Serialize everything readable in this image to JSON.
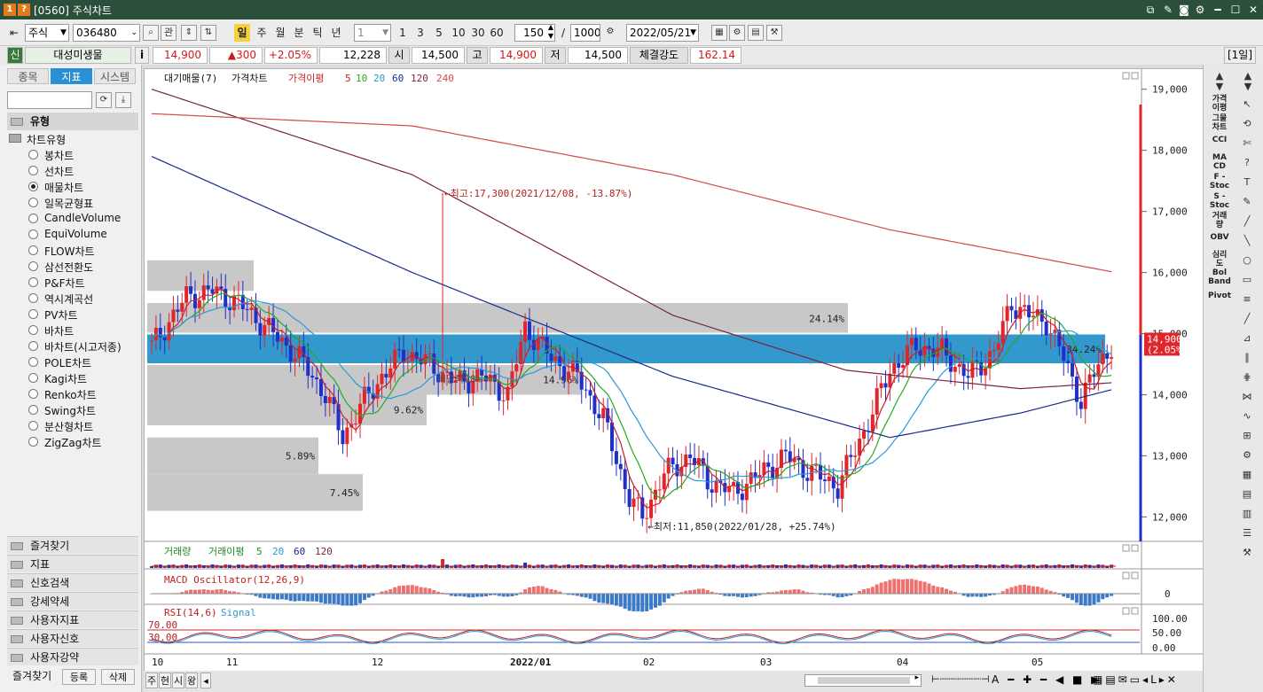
{
  "window": {
    "badge1": "1",
    "badge2": "?",
    "title": "[0560] 주식차트"
  },
  "toolbar": {
    "market": "주식",
    "code": "036480",
    "btn_kwan": "관",
    "periods": [
      "일",
      "주",
      "월",
      "분",
      "틱",
      "년"
    ],
    "period_unit": "1",
    "intervals": [
      "1",
      "3",
      "5",
      "10",
      "30",
      "60"
    ],
    "count": "150",
    "slash": "/",
    "total": "1000",
    "date": "2022/05/21"
  },
  "quote": {
    "sin": "신",
    "name": "대성미생물",
    "info": "i",
    "price": "14,900",
    "change": "▲300",
    "pct": "+2.05%",
    "volume": "12,228",
    "open_label": "시",
    "open": "14,500",
    "high_label": "고",
    "high": "14,900",
    "low_label": "저",
    "low": "14,500",
    "strength_label": "체결강도",
    "strength": "162.14",
    "period_badge": "[1일]"
  },
  "left": {
    "tabs": [
      "종목",
      "지표",
      "시스템"
    ],
    "category": "유형",
    "tree_root": "차트유형",
    "chart_types": [
      "봉차트",
      "선차트",
      "매물차트",
      "일목균형표",
      "CandleVolume",
      "EquiVolume",
      "FLOW차트",
      "삼선전환도",
      "P&F차트",
      "역시계곡선",
      "PV차트",
      "바차트",
      "바차트(시고저종)",
      "POLE차트",
      "Kagi차트",
      "Renko차트",
      "Swing차트",
      "분산형차트",
      "ZigZag차트"
    ],
    "selected": "매물차트",
    "sections": [
      "즐겨찾기",
      "지표",
      "신호검색",
      "강세약세",
      "사용자지표",
      "사용자신호",
      "사용자강약"
    ],
    "bottom": [
      "즐겨찾기",
      "등록",
      "삭제"
    ]
  },
  "legend": {
    "main": [
      "대기매물(7)",
      "가격차트",
      "가격이평",
      "5",
      "10",
      "20",
      "60",
      "120",
      "240"
    ],
    "vol": [
      "거래량",
      "거래이평",
      "5",
      "20",
      "60",
      "120"
    ],
    "macd": "MACD Oscillator(12,26,9)",
    "rsi": [
      "RSI(14,6)",
      "Signal"
    ]
  },
  "annotations": {
    "high": "←최고:17,300(2021/12/08, -13.87%)",
    "low": "←최저:11,850(2022/01/28, +25.74%)",
    "bandlabel": "배당락18%"
  },
  "colors": {
    "up": "#e0262b",
    "down": "#1f2fc8",
    "band": "#3399cc",
    "ma5": "#c8202a",
    "ma10": "#22aa22",
    "ma20": "#2a9ad6",
    "ma60": "#1a2a88",
    "ma120": "#7a2440",
    "ma240": "#d24a4a"
  },
  "chart_data": {
    "type": "candlestick",
    "y_ticks": [
      "19,000",
      "18,000",
      "17,000",
      "16,000",
      "15,000",
      "14,000",
      "13,000",
      "12,000"
    ],
    "ylim": [
      11600,
      19300
    ],
    "x_ticks": [
      "10",
      "11",
      "12",
      "2022/01",
      "02",
      "03",
      "04",
      "05"
    ],
    "current_price": "14,900",
    "current_pct": "(2.05%)",
    "volume_profile": [
      {
        "from": 15700,
        "to": 16200,
        "pct": ""
      },
      {
        "from": 15000,
        "to": 15500,
        "pct": "24.14%"
      },
      {
        "from": 14500,
        "to": 15000,
        "pct": "34.24%"
      },
      {
        "from": 14000,
        "to": 14500,
        "pct": "14.96%"
      },
      {
        "from": 13500,
        "to": 14000,
        "pct": "9.62%"
      },
      {
        "from": 12700,
        "to": 13300,
        "pct": "5.89%"
      },
      {
        "from": 12100,
        "to": 12700,
        "pct": "7.45%"
      }
    ],
    "macd_zero": "0",
    "rsi_ticks": [
      "100.00",
      "50.00",
      "0.00"
    ],
    "rsi_levels": [
      "70.00",
      "30.00"
    ]
  },
  "bottombar": {
    "tabs": [
      "주",
      "현",
      "시",
      "왕"
    ]
  }
}
